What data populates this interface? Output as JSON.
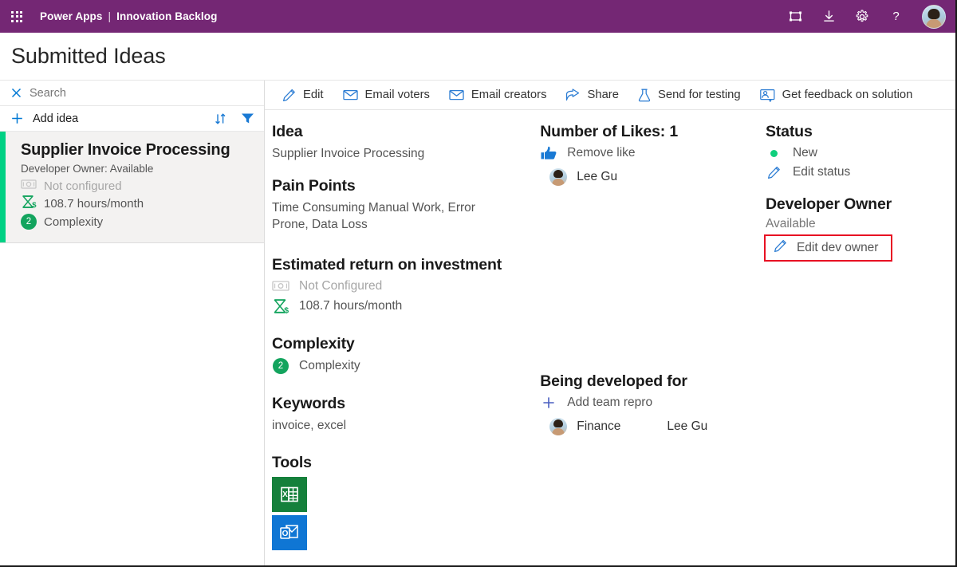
{
  "topbar": {
    "waffle_label": "app-launcher",
    "brand": "Power Apps",
    "separator": "|",
    "app_name": "Innovation Backlog",
    "icons": [
      {
        "name": "fullscreen-icon",
        "label": "Fullscreen"
      },
      {
        "name": "download-icon",
        "label": "Download"
      },
      {
        "name": "gear-icon",
        "label": "Settings"
      },
      {
        "name": "help-icon",
        "label": "Help"
      }
    ],
    "avatar_label": "Lee Gu"
  },
  "page": {
    "title": "Submitted Ideas"
  },
  "sidebar": {
    "search": {
      "placeholder": "Search",
      "value": "",
      "clear_icon": "close-icon"
    },
    "add_idea": {
      "label": "Add idea",
      "icon": "plus-icon"
    },
    "sort_icon": "sort-icon",
    "filter_icon": "filter-icon",
    "cards": [
      {
        "title": "Supplier Invoice Processing",
        "subtitle": "Developer Owner: Available",
        "roi_money": "Not configured",
        "roi_hours": "108.7 hours/month",
        "complexity_value": "2",
        "complexity_label": "Complexity",
        "accent_color": "#00d184"
      }
    ]
  },
  "commandbar": {
    "commands": [
      {
        "label": "Edit",
        "icon": "pencil-icon"
      },
      {
        "label": "Email voters",
        "icon": "mail-icon"
      },
      {
        "label": "Email creators",
        "icon": "mail-icon"
      },
      {
        "label": "Share",
        "icon": "share-icon"
      },
      {
        "label": "Send for testing",
        "icon": "flask-icon"
      },
      {
        "label": "Get feedback on solution",
        "icon": "feedback-person-icon"
      }
    ]
  },
  "detail": {
    "idea": {
      "heading": "Idea",
      "value": "Supplier Invoice Processing"
    },
    "pain_points": {
      "heading": "Pain Points",
      "value": "Time Consuming Manual Work, Error Prone, Data Loss"
    },
    "roi": {
      "heading": "Estimated return on investment",
      "money_label": "Not Configured",
      "money_icon": "banknote-icon",
      "hours_label": "108.7 hours/month",
      "hours_icon": "hourglass-dollar-icon"
    },
    "complexity": {
      "heading": "Complexity",
      "value": "2",
      "label": "Complexity"
    },
    "keywords": {
      "heading": "Keywords",
      "value": "invoice, excel"
    },
    "tools": {
      "heading": "Tools",
      "items": [
        {
          "name": "excel-icon",
          "label": "Excel",
          "color": "#15803b"
        },
        {
          "name": "outlook-icon",
          "label": "Outlook",
          "color": "#0f76d4"
        }
      ]
    },
    "likes": {
      "heading": "Number of Likes: 1",
      "action_label": "Remove like",
      "action_icon": "thumbs-up-icon",
      "voters": [
        "Lee Gu"
      ]
    },
    "developed_for": {
      "heading": "Being developed for",
      "action_label": "Add team repro",
      "action_icon": "plus-icon",
      "rows": [
        {
          "team": "Finance",
          "person": "Lee Gu"
        }
      ]
    },
    "status": {
      "heading": "Status",
      "value": "New",
      "dot_color": "#10cf7d",
      "edit_label": "Edit status",
      "edit_icon": "pencil-icon"
    },
    "developer_owner": {
      "heading": "Developer Owner",
      "value": "Available",
      "edit_label": "Edit dev owner",
      "edit_icon": "pencil-icon",
      "highlight_color": "#e81123"
    }
  }
}
